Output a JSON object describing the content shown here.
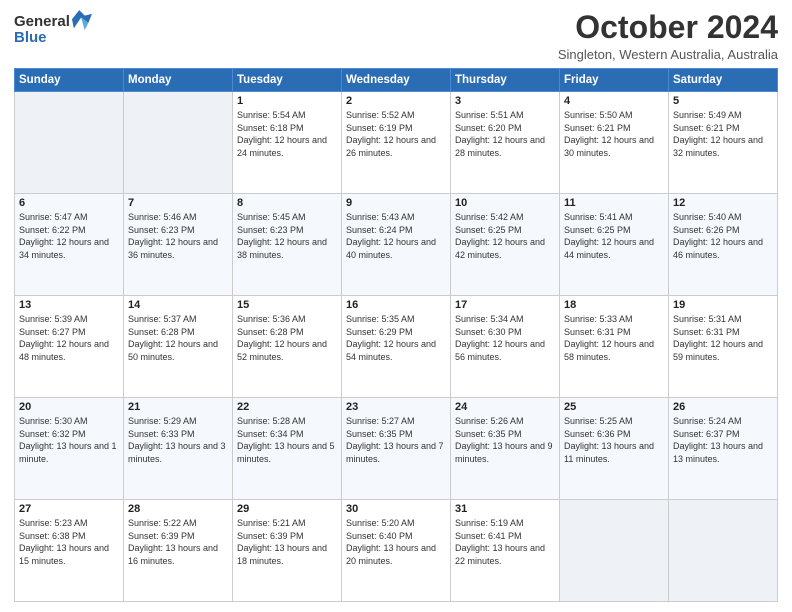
{
  "header": {
    "logo_general": "General",
    "logo_blue": "Blue",
    "month_title": "October 2024",
    "location": "Singleton, Western Australia, Australia"
  },
  "days_of_week": [
    "Sunday",
    "Monday",
    "Tuesday",
    "Wednesday",
    "Thursday",
    "Friday",
    "Saturday"
  ],
  "weeks": [
    [
      {
        "day": "",
        "info": ""
      },
      {
        "day": "",
        "info": ""
      },
      {
        "day": "1",
        "info": "Sunrise: 5:54 AM\nSunset: 6:18 PM\nDaylight: 12 hours and 24 minutes."
      },
      {
        "day": "2",
        "info": "Sunrise: 5:52 AM\nSunset: 6:19 PM\nDaylight: 12 hours and 26 minutes."
      },
      {
        "day": "3",
        "info": "Sunrise: 5:51 AM\nSunset: 6:20 PM\nDaylight: 12 hours and 28 minutes."
      },
      {
        "day": "4",
        "info": "Sunrise: 5:50 AM\nSunset: 6:21 PM\nDaylight: 12 hours and 30 minutes."
      },
      {
        "day": "5",
        "info": "Sunrise: 5:49 AM\nSunset: 6:21 PM\nDaylight: 12 hours and 32 minutes."
      }
    ],
    [
      {
        "day": "6",
        "info": "Sunrise: 5:47 AM\nSunset: 6:22 PM\nDaylight: 12 hours and 34 minutes."
      },
      {
        "day": "7",
        "info": "Sunrise: 5:46 AM\nSunset: 6:23 PM\nDaylight: 12 hours and 36 minutes."
      },
      {
        "day": "8",
        "info": "Sunrise: 5:45 AM\nSunset: 6:23 PM\nDaylight: 12 hours and 38 minutes."
      },
      {
        "day": "9",
        "info": "Sunrise: 5:43 AM\nSunset: 6:24 PM\nDaylight: 12 hours and 40 minutes."
      },
      {
        "day": "10",
        "info": "Sunrise: 5:42 AM\nSunset: 6:25 PM\nDaylight: 12 hours and 42 minutes."
      },
      {
        "day": "11",
        "info": "Sunrise: 5:41 AM\nSunset: 6:25 PM\nDaylight: 12 hours and 44 minutes."
      },
      {
        "day": "12",
        "info": "Sunrise: 5:40 AM\nSunset: 6:26 PM\nDaylight: 12 hours and 46 minutes."
      }
    ],
    [
      {
        "day": "13",
        "info": "Sunrise: 5:39 AM\nSunset: 6:27 PM\nDaylight: 12 hours and 48 minutes."
      },
      {
        "day": "14",
        "info": "Sunrise: 5:37 AM\nSunset: 6:28 PM\nDaylight: 12 hours and 50 minutes."
      },
      {
        "day": "15",
        "info": "Sunrise: 5:36 AM\nSunset: 6:28 PM\nDaylight: 12 hours and 52 minutes."
      },
      {
        "day": "16",
        "info": "Sunrise: 5:35 AM\nSunset: 6:29 PM\nDaylight: 12 hours and 54 minutes."
      },
      {
        "day": "17",
        "info": "Sunrise: 5:34 AM\nSunset: 6:30 PM\nDaylight: 12 hours and 56 minutes."
      },
      {
        "day": "18",
        "info": "Sunrise: 5:33 AM\nSunset: 6:31 PM\nDaylight: 12 hours and 58 minutes."
      },
      {
        "day": "19",
        "info": "Sunrise: 5:31 AM\nSunset: 6:31 PM\nDaylight: 12 hours and 59 minutes."
      }
    ],
    [
      {
        "day": "20",
        "info": "Sunrise: 5:30 AM\nSunset: 6:32 PM\nDaylight: 13 hours and 1 minute."
      },
      {
        "day": "21",
        "info": "Sunrise: 5:29 AM\nSunset: 6:33 PM\nDaylight: 13 hours and 3 minutes."
      },
      {
        "day": "22",
        "info": "Sunrise: 5:28 AM\nSunset: 6:34 PM\nDaylight: 13 hours and 5 minutes."
      },
      {
        "day": "23",
        "info": "Sunrise: 5:27 AM\nSunset: 6:35 PM\nDaylight: 13 hours and 7 minutes."
      },
      {
        "day": "24",
        "info": "Sunrise: 5:26 AM\nSunset: 6:35 PM\nDaylight: 13 hours and 9 minutes."
      },
      {
        "day": "25",
        "info": "Sunrise: 5:25 AM\nSunset: 6:36 PM\nDaylight: 13 hours and 11 minutes."
      },
      {
        "day": "26",
        "info": "Sunrise: 5:24 AM\nSunset: 6:37 PM\nDaylight: 13 hours and 13 minutes."
      }
    ],
    [
      {
        "day": "27",
        "info": "Sunrise: 5:23 AM\nSunset: 6:38 PM\nDaylight: 13 hours and 15 minutes."
      },
      {
        "day": "28",
        "info": "Sunrise: 5:22 AM\nSunset: 6:39 PM\nDaylight: 13 hours and 16 minutes."
      },
      {
        "day": "29",
        "info": "Sunrise: 5:21 AM\nSunset: 6:39 PM\nDaylight: 13 hours and 18 minutes."
      },
      {
        "day": "30",
        "info": "Sunrise: 5:20 AM\nSunset: 6:40 PM\nDaylight: 13 hours and 20 minutes."
      },
      {
        "day": "31",
        "info": "Sunrise: 5:19 AM\nSunset: 6:41 PM\nDaylight: 13 hours and 22 minutes."
      },
      {
        "day": "",
        "info": ""
      },
      {
        "day": "",
        "info": ""
      }
    ]
  ]
}
